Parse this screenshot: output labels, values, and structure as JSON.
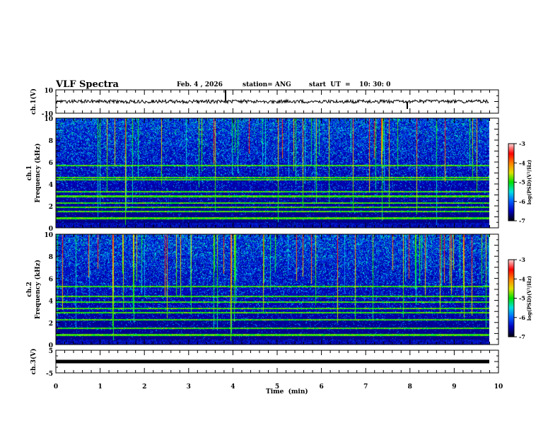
{
  "header": {
    "title": "VLF Spectra",
    "date": "Feb. 4  , 2026",
    "station": "station= ANG",
    "start": "start  UT  =    10: 30: 0"
  },
  "chart_data": {
    "type": "heatmap",
    "xlabel": "Time  (min)",
    "xlim": [
      0,
      10
    ],
    "xticks": [
      "0",
      "1",
      "2",
      "3",
      "4",
      "5",
      "6",
      "7",
      "8",
      "9",
      "10"
    ],
    "panels": [
      {
        "kind": "line",
        "ylabel": "ch.1(V)",
        "ylim": [
          -10,
          10
        ],
        "yticks": [
          "10",
          "-10"
        ],
        "baseline": 0
      },
      {
        "kind": "heatmap",
        "ylabel_top": "ch.1",
        "ylabel": "Frequency  (kHz)",
        "ylim": [
          0,
          10
        ],
        "yticks": [
          "0",
          "2",
          "4",
          "6",
          "8",
          "10"
        ],
        "colorbar": {
          "label": "log(PSD)(V²/Hz)",
          "range": [
            -7,
            -3
          ],
          "ticks": [
            "-3",
            "-4",
            "-5",
            "-6",
            "-7"
          ]
        },
        "tone_lines_khz": [
          0.9,
          1.5,
          1.9,
          2.3,
          2.9,
          3.3,
          4.4,
          4.6,
          5.7
        ]
      },
      {
        "kind": "heatmap",
        "ylabel_top": "ch.2",
        "ylabel": "Frequency  (kHz)",
        "ylim": [
          0,
          10
        ],
        "yticks": [
          "0",
          "2",
          "4",
          "6",
          "8",
          "10"
        ],
        "colorbar": {
          "label": "log(PSD)(V²/Hz)",
          "range": [
            -7,
            -3
          ],
          "ticks": [
            "-3",
            "-4",
            "-5",
            "-6",
            "-7"
          ]
        },
        "tone_lines_khz": [
          0.9,
          1.5,
          2.3,
          2.9,
          3.3,
          3.9,
          4.4,
          5.3
        ]
      },
      {
        "kind": "line",
        "ylabel": "ch.3(V)",
        "ylim": [
          -5,
          5
        ],
        "yticks": [
          "5",
          "-5"
        ],
        "baseline": 0
      }
    ],
    "data_end_min": 9.8,
    "colormap": [
      "#000010",
      "#0000c0",
      "#0060ff",
      "#00e0e0",
      "#00e000",
      "#e0e000",
      "#ff8000",
      "#ff0000",
      "#ffd0d0"
    ]
  }
}
